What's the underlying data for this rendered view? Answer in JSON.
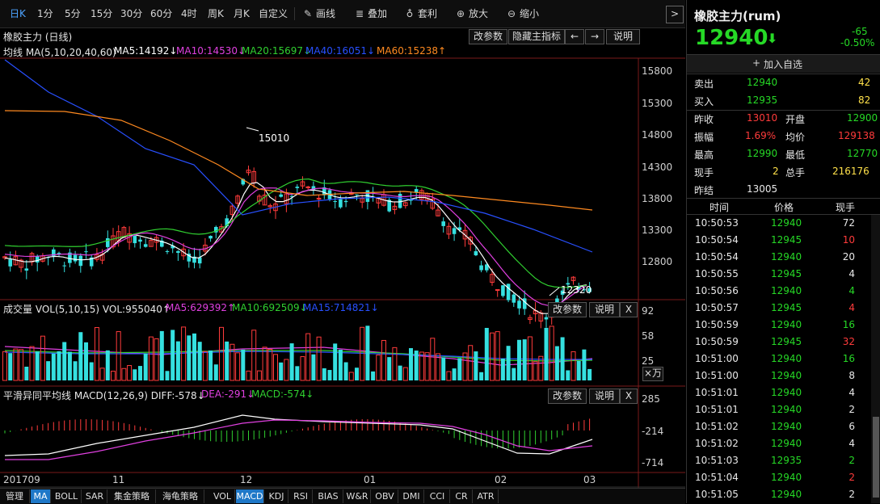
{
  "toolbar": {
    "items": [
      "日K",
      "1分",
      "5分",
      "15分",
      "30分",
      "60分",
      "4时",
      "周K",
      "月K",
      "自定义"
    ],
    "tools": [
      "画线",
      "叠加",
      "套利",
      "放大",
      "缩小"
    ],
    "next_label": ">"
  },
  "main": {
    "title": "橡胶主力 (日线)",
    "buttons": [
      "改参数",
      "隐藏主指标",
      "←",
      "→",
      "说明"
    ],
    "ma_label": "均线 MA(5,10,20,40,60)",
    "ma_values": [
      "MA5:14192↓",
      "MA10:14530↓",
      "MA20:15697↓",
      "MA40:16051↓",
      "MA60:15238↑"
    ],
    "price_ticks": [
      "15800",
      "15300",
      "14800",
      "14300",
      "13800",
      "13300",
      "12800"
    ],
    "high_label": "15010",
    "low_label": "12320"
  },
  "volume": {
    "label": "成交量 VOL(5,10,15) VOL:955040↑",
    "values": [
      "MA5:629392↑",
      "MA10:692509↓",
      "MA15:714821↓"
    ],
    "buttons": [
      "改参数",
      "说明",
      "X"
    ],
    "ticks": [
      "92",
      "58",
      "25"
    ],
    "unit": "×万"
  },
  "macd": {
    "label": "平滑异同平均线 MACD(12,26,9) DIFF:-578↓",
    "values": [
      "DEA:-291↓",
      "MACD:-574↓"
    ],
    "buttons": [
      "改参数",
      "说明",
      "X"
    ],
    "ticks": [
      "285",
      "-214",
      "-714"
    ]
  },
  "time_axis": [
    "201709",
    "11",
    "12",
    "01",
    "02",
    "03"
  ],
  "tabs": [
    "管理",
    "MA",
    "BOLL",
    "SAR",
    "集金策略",
    "海龟策略",
    "VOL",
    "MACD",
    "KDJ",
    "RSI",
    "BIAS",
    "W&R",
    "OBV",
    "DMI",
    "CCI",
    "CR",
    "ATR"
  ],
  "panel": {
    "title": "橡胶主力(rum)",
    "price": "12940",
    "change": "-65",
    "change_pct": "-0.50%",
    "add_watch": "加入自选",
    "sell_label": "卖出",
    "sell_price": "12940",
    "sell_qty": "42",
    "buy_label": "买入",
    "buy_price": "12935",
    "buy_qty": "82",
    "stats": [
      {
        "k": "昨收",
        "v": "13010",
        "k2": "开盘",
        "v2": "12900"
      },
      {
        "k": "振幅",
        "v": "1.69%",
        "k2": "均价",
        "v2": "129138"
      },
      {
        "k": "最高",
        "v": "12990",
        "k2": "最低",
        "v2": "12770"
      },
      {
        "k": "现手",
        "v": "2",
        "k2": "总手",
        "v2": "216176"
      },
      {
        "k": "昨结",
        "v": "13005",
        "k2": "",
        "v2": ""
      }
    ],
    "ticks_header": [
      "时间",
      "价格",
      "现手"
    ],
    "ticks": [
      {
        "t": "10:50:53",
        "p": "12940",
        "q": "72",
        "c": "w"
      },
      {
        "t": "10:50:54",
        "p": "12945",
        "q": "10",
        "c": "r"
      },
      {
        "t": "10:50:54",
        "p": "12940",
        "q": "20",
        "c": "w"
      },
      {
        "t": "10:50:55",
        "p": "12945",
        "q": "4",
        "c": "w"
      },
      {
        "t": "10:50:56",
        "p": "12940",
        "q": "4",
        "c": "g"
      },
      {
        "t": "10:50:57",
        "p": "12945",
        "q": "4",
        "c": "r"
      },
      {
        "t": "10:50:59",
        "p": "12940",
        "q": "16",
        "c": "g"
      },
      {
        "t": "10:50:59",
        "p": "12945",
        "q": "32",
        "c": "r"
      },
      {
        "t": "10:51:00",
        "p": "12940",
        "q": "16",
        "c": "g"
      },
      {
        "t": "10:51:00",
        "p": "12940",
        "q": "8",
        "c": "w"
      },
      {
        "t": "10:51:01",
        "p": "12940",
        "q": "4",
        "c": "w"
      },
      {
        "t": "10:51:01",
        "p": "12940",
        "q": "2",
        "c": "w"
      },
      {
        "t": "10:51:02",
        "p": "12940",
        "q": "6",
        "c": "w"
      },
      {
        "t": "10:51:02",
        "p": "12940",
        "q": "4",
        "c": "w"
      },
      {
        "t": "10:51:03",
        "p": "12935",
        "q": "2",
        "c": "g"
      },
      {
        "t": "10:51:04",
        "p": "12940",
        "q": "2",
        "c": "r"
      },
      {
        "t": "10:51:05",
        "p": "12940",
        "q": "2",
        "c": "w"
      }
    ]
  },
  "colors": {
    "up": "#ff3b3b",
    "down": "#35e0e0",
    "ma5": "#ffffff",
    "ma10": "#e040e0",
    "ma20": "#30d030",
    "ma40": "#2850ff",
    "ma60": "#ff8a20"
  }
}
